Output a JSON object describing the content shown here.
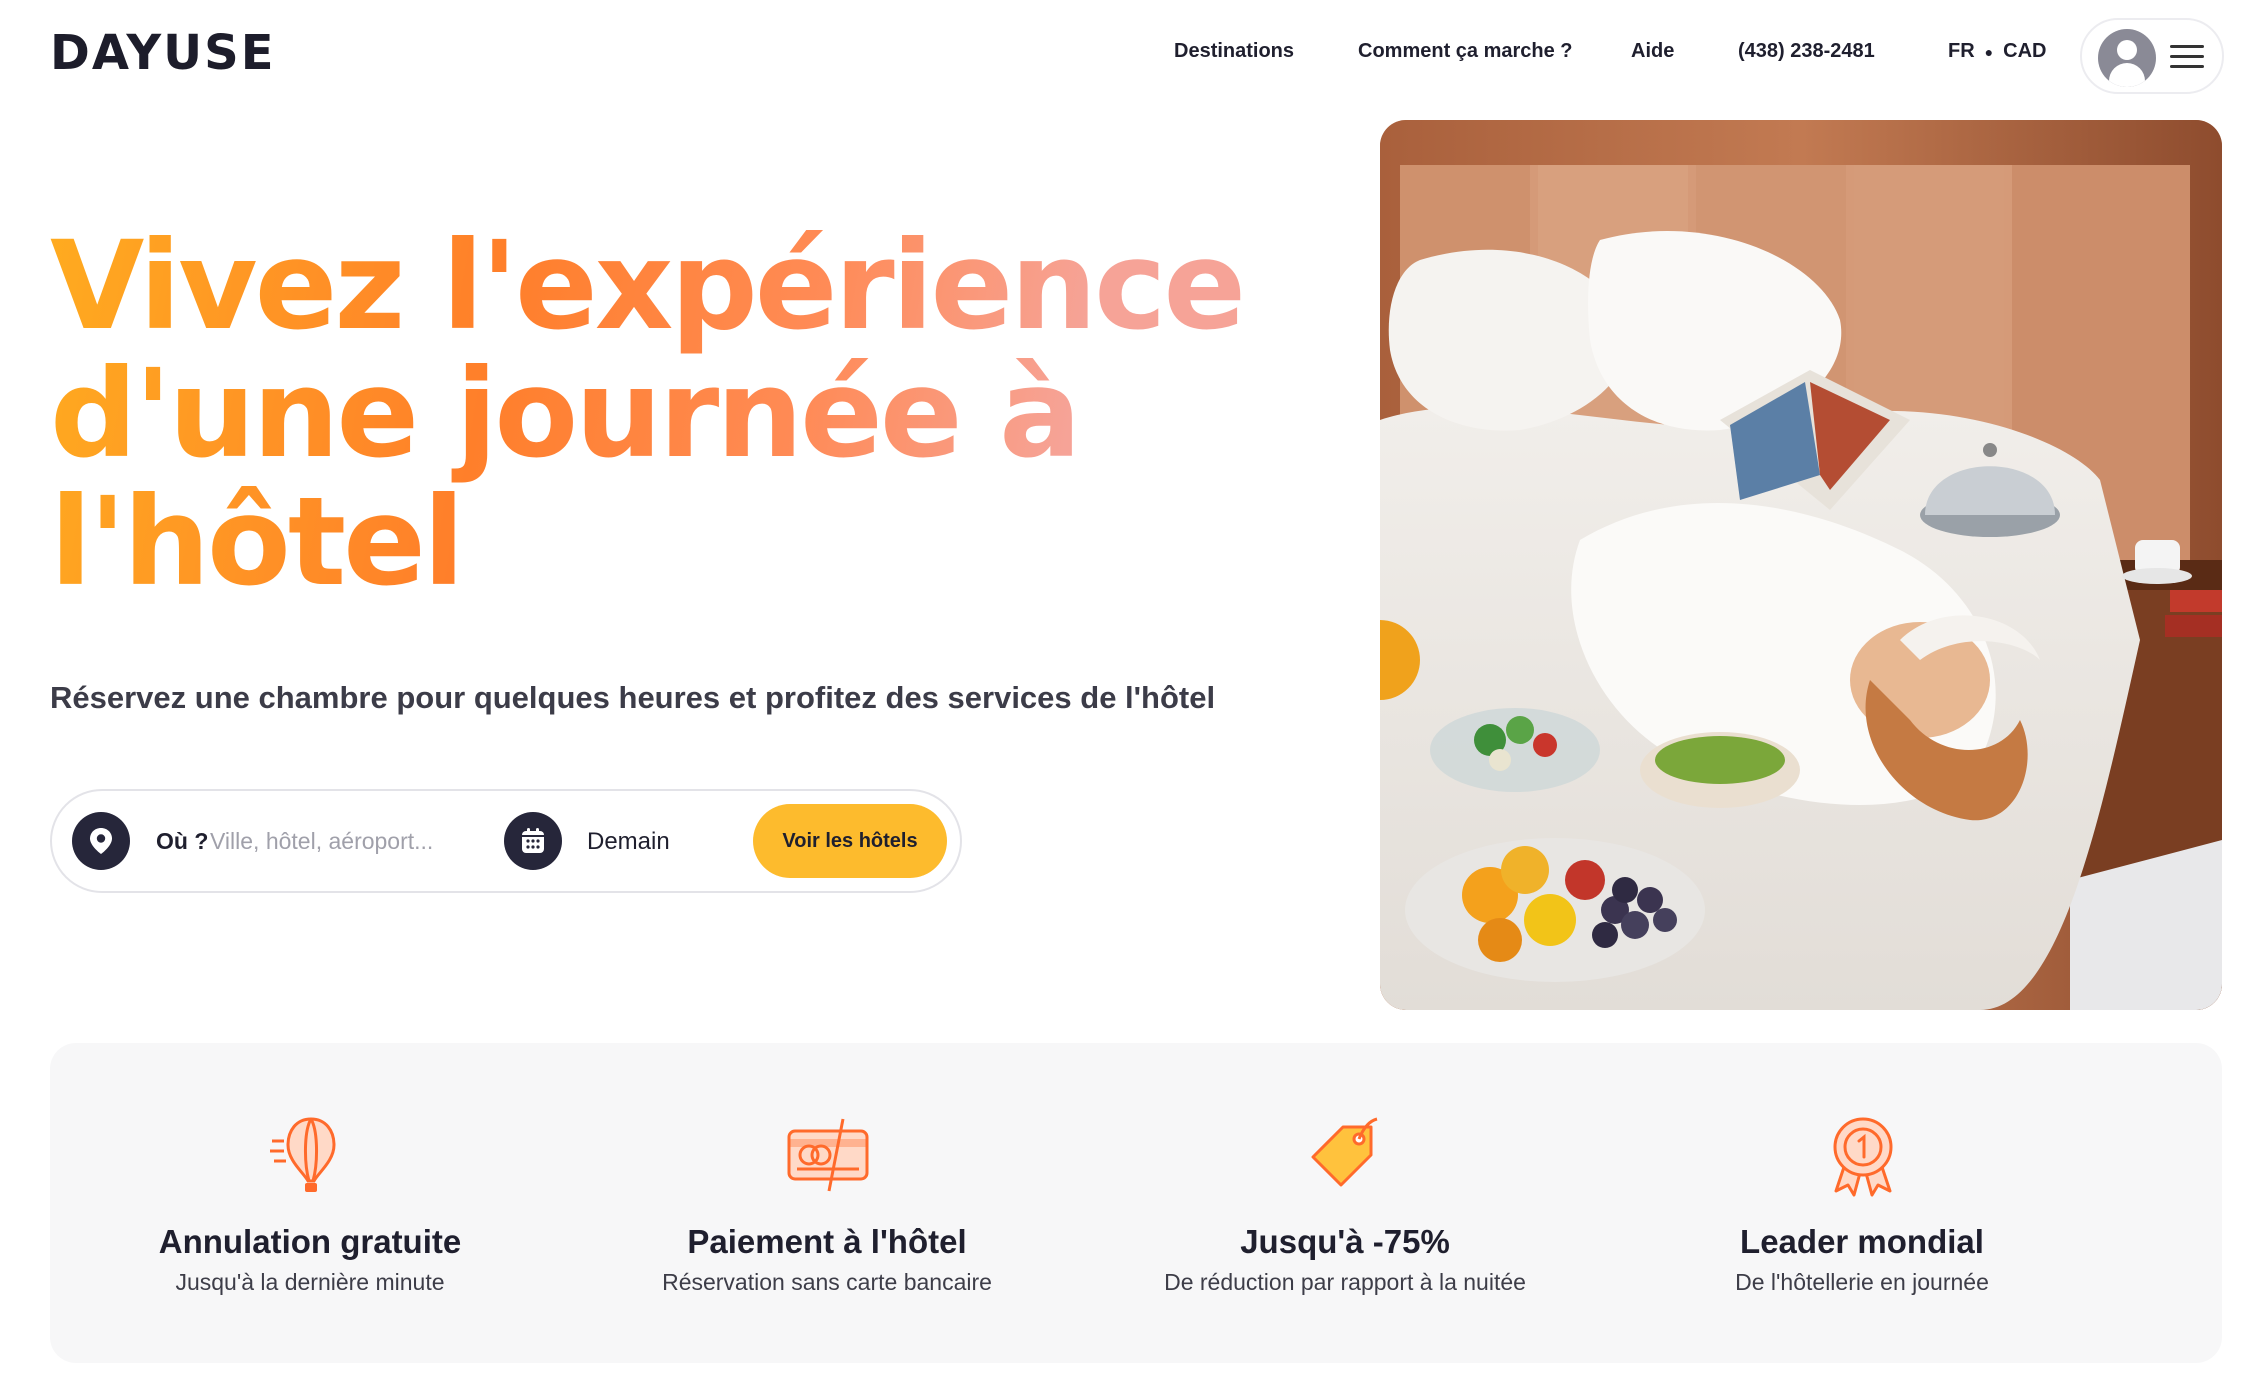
{
  "brand": {
    "name": "DAYUSE"
  },
  "nav": {
    "destinations": "Destinations",
    "how_it_works": "Comment ça marche ?",
    "help": "Aide",
    "phone": "(438) 238-2481",
    "language": "FR",
    "currency": "CAD",
    "account_icon": "user-avatar-icon",
    "menu_icon": "hamburger-menu-icon"
  },
  "hero": {
    "title_lines": [
      "Vivez l'expérience",
      "d'une journée à",
      "l'hôtel"
    ],
    "subtitle": "Réservez une chambre pour quelques heures et profitez des services de l'hôtel",
    "gradient_colors": [
      "#ffab1f",
      "#ff7f2a",
      "#ff8b57",
      "#f6a397"
    ]
  },
  "search": {
    "where_label": "Où ?",
    "where_placeholder": "Ville, hôtel, aéroport...",
    "date_value": "Demain",
    "cta_label": "Voir les hôtels",
    "cta_color": "#fdbb2d",
    "location_icon": "map-pin-icon",
    "date_icon": "calendar-icon"
  },
  "features": [
    {
      "icon": "hot-air-balloon-icon",
      "title": "Annulation gratuite",
      "description": "Jusqu'à la dernière minute"
    },
    {
      "icon": "credit-card-icon",
      "title": "Paiement à l'hôtel",
      "description": "Réservation sans carte bancaire"
    },
    {
      "icon": "price-tag-icon",
      "title": "Jusqu'à -75%",
      "description": "De réduction par rapport à la nuitée"
    },
    {
      "icon": "award-medal-icon",
      "title": "Leader mondial",
      "description": "De l'hôtellerie en journée"
    }
  ],
  "colors": {
    "accent": "#ff7a2f",
    "dark": "#1f1f2e",
    "feature_bg": "#f7f7f8"
  }
}
